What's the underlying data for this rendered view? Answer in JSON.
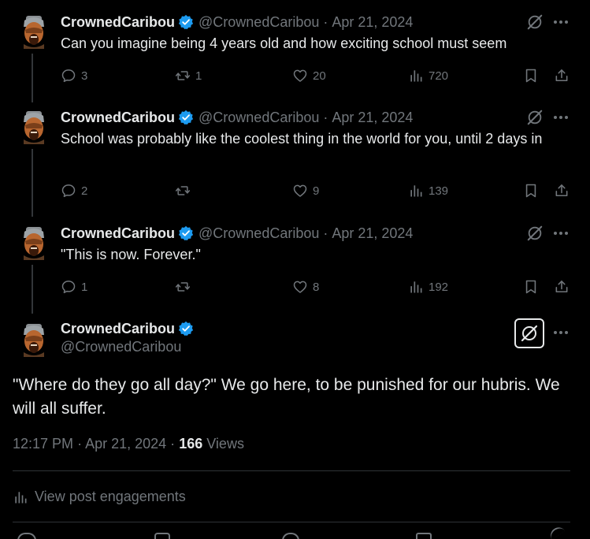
{
  "colors": {
    "background": "#000000",
    "text": "#e7e9ea",
    "muted": "#71767b",
    "verified": "#1d9bf0"
  },
  "tweets": [
    {
      "name": "CrownedCaribou",
      "handle": "@CrownedCaribou",
      "separator": "·",
      "date": "Apr 21, 2024",
      "text": "Can you imagine being 4 years old and how exciting school must seem",
      "replies": "3",
      "reposts": "1",
      "likes": "20",
      "views": "720"
    },
    {
      "name": "CrownedCaribou",
      "handle": "@CrownedCaribou",
      "separator": "·",
      "date": "Apr 21, 2024",
      "text": "School was probably like the coolest thing in the world for you, until 2 days in",
      "replies": "2",
      "reposts": "",
      "likes": "9",
      "views": "139"
    },
    {
      "name": "CrownedCaribou",
      "handle": "@CrownedCaribou",
      "separator": "·",
      "date": "Apr 21, 2024",
      "text": "\"This is now. Forever.\"",
      "replies": "1",
      "reposts": "",
      "likes": "8",
      "views": "192"
    }
  ],
  "main": {
    "name": "CrownedCaribou",
    "handle": "@CrownedCaribou",
    "text": "\"Where do they go all day?\" We go here, to be punished for our hubris. We will all suffer.",
    "time": "12:17 PM",
    "separator": "·",
    "date": "Apr 21, 2024",
    "separator2": "·",
    "views_count": "166",
    "views_label": "Views",
    "engagements_label": "View post engagements"
  }
}
